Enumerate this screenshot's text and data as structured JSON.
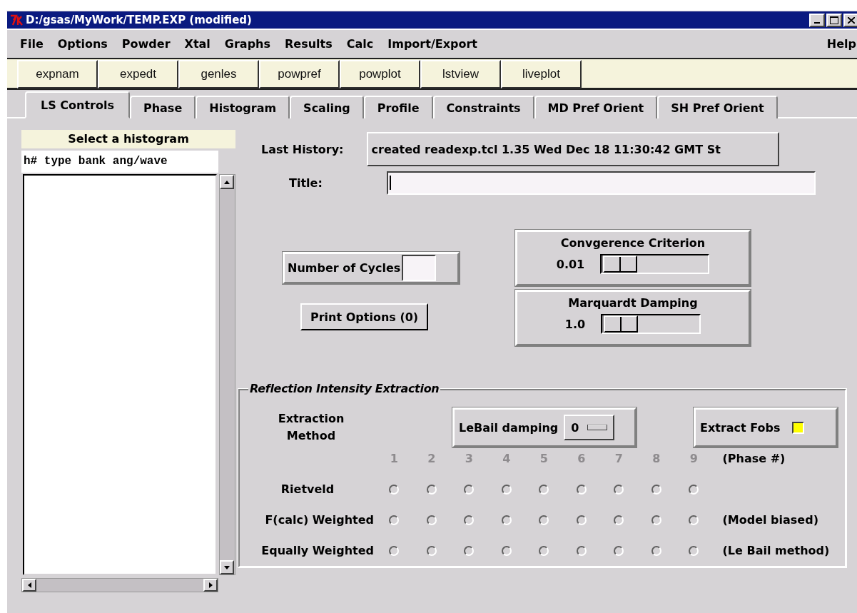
{
  "window": {
    "title": "D:/gsas/MyWork/TEMP.EXP (modified)"
  },
  "menus": [
    "File",
    "Options",
    "Powder",
    "Xtal",
    "Graphs",
    "Results",
    "Calc",
    "Import/Export"
  ],
  "help_menu": "Help",
  "toolbar": [
    "expnam",
    "expedt",
    "genles",
    "powpref",
    "powplot",
    "lstview",
    "liveplot"
  ],
  "tabs": [
    {
      "label": "LS Controls",
      "selected": true
    },
    {
      "label": "Phase",
      "selected": false
    },
    {
      "label": "Histogram",
      "selected": false
    },
    {
      "label": "Scaling",
      "selected": false
    },
    {
      "label": "Profile",
      "selected": false
    },
    {
      "label": "Constraints",
      "selected": false
    },
    {
      "label": "MD Pref Orient",
      "selected": false
    },
    {
      "label": "SH Pref Orient",
      "selected": false
    }
  ],
  "histogram_list": {
    "title": "Select a histogram",
    "header": "h# type bank ang/wave"
  },
  "last_history": {
    "label": "Last History:",
    "value": "created readexp.tcl 1.35 Wed Dec 18 11:30:42 GMT St"
  },
  "title_field": {
    "label": "Title:"
  },
  "cycles": {
    "label": "Number of Cycles"
  },
  "print_options": "Print Options (0)",
  "sliders": [
    {
      "title": "Convgerence Criterion",
      "reading": "0.01",
      "level": 0
    },
    {
      "title": "Marquardt Damping",
      "reading": "1.0",
      "level": 0
    }
  ],
  "extraction": {
    "title": "Reflection Intensity Extraction",
    "method_label": "Extraction Method",
    "lebail": {
      "label": "LeBail damping",
      "value": "0"
    },
    "extract_fobs": {
      "label": "Extract Fobs",
      "checked": true
    },
    "phases": [
      {
        "label": "1",
        "disabled": true
      },
      {
        "label": "2",
        "disabled": true
      },
      {
        "label": "3",
        "disabled": true
      },
      {
        "label": "4",
        "disabled": true
      },
      {
        "label": "5",
        "disabled": true
      },
      {
        "label": "6",
        "disabled": true
      },
      {
        "label": "7",
        "disabled": true
      },
      {
        "label": "8",
        "disabled": true
      },
      {
        "label": "9",
        "disabled": true
      }
    ],
    "phase_note": "(Phase #)",
    "rows": [
      {
        "label": "Rietveld",
        "radios": [
          {
            "selected": false
          },
          {
            "selected": false
          },
          {
            "selected": false
          },
          {
            "selected": false
          },
          {
            "selected": false
          },
          {
            "selected": false
          },
          {
            "selected": false
          },
          {
            "selected": false
          },
          {
            "selected": false
          }
        ]
      },
      {
        "label": "F(calc) Weighted",
        "note": "(Model biased)",
        "radios": [
          {
            "selected": false
          },
          {
            "selected": false
          },
          {
            "selected": false
          },
          {
            "selected": false
          },
          {
            "selected": false
          },
          {
            "selected": false
          },
          {
            "selected": false
          },
          {
            "selected": false
          },
          {
            "selected": false
          }
        ]
      },
      {
        "label": "Equally Weighted",
        "note": "(Le Bail method)",
        "radios": [
          {
            "selected": false
          },
          {
            "selected": false
          },
          {
            "selected": false
          },
          {
            "selected": false
          },
          {
            "selected": false
          },
          {
            "selected": false
          },
          {
            "selected": false
          },
          {
            "selected": false
          },
          {
            "selected": false
          }
        ]
      }
    ]
  }
}
